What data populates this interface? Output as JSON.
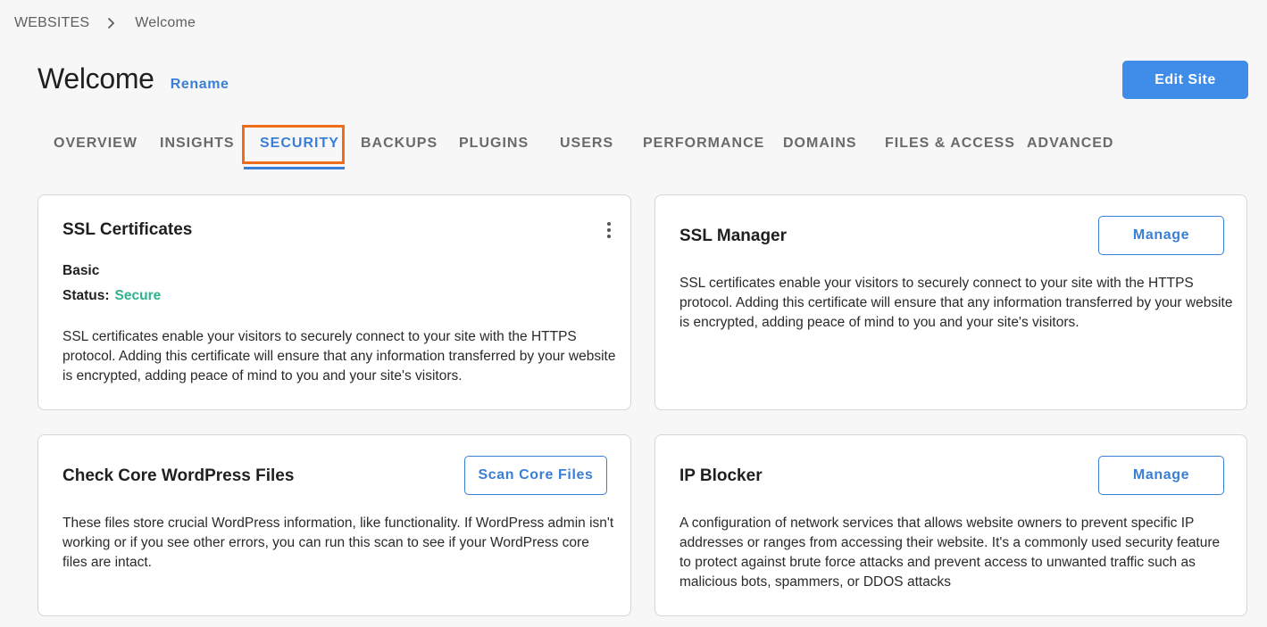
{
  "breadcrumb": {
    "root": "WEBSITES",
    "current": "Welcome"
  },
  "page": {
    "title": "Welcome",
    "rename_label": "Rename",
    "edit_button": "Edit Site"
  },
  "tabs": [
    {
      "label": "OVERVIEW"
    },
    {
      "label": "INSIGHTS"
    },
    {
      "label": "SECURITY",
      "active": true
    },
    {
      "label": "BACKUPS"
    },
    {
      "label": "PLUGINS"
    },
    {
      "label": "USERS"
    },
    {
      "label": "PERFORMANCE"
    },
    {
      "label": "DOMAINS"
    },
    {
      "label": "FILES & ACCESS"
    },
    {
      "label": "ADVANCED"
    }
  ],
  "cards": {
    "ssl_certificates": {
      "title": "SSL Certificates",
      "plan": "Basic",
      "status_label": "Status:",
      "status_value": "Secure",
      "description": "SSL certificates enable your visitors to securely connect to your site with the HTTPS protocol. Adding this certificate will ensure that any information transferred by your website is encrypted, adding peace of mind to you and your site's visitors."
    },
    "ssl_manager": {
      "title": "SSL Manager",
      "button": "Manage",
      "description": "SSL certificates enable your visitors to securely connect to your site with the HTTPS protocol. Adding this certificate will ensure that any information transferred by your website is encrypted, adding peace of mind to you and your site's visitors."
    },
    "core_files": {
      "title": "Check Core WordPress Files",
      "button": "Scan Core Files",
      "description": "These files store crucial WordPress information, like functionality. If WordPress admin isn't working or if you see other errors, you can run this scan to see if your WordPress core files are intact."
    },
    "ip_blocker": {
      "title": "IP Blocker",
      "button": "Manage",
      "description": "A configuration of network services that allows website owners to prevent specific IP addresses or ranges from accessing their website. It's a commonly used security feature to protect against brute force attacks and prevent access to unwanted traffic such as malicious bots, spammers, or DDOS attacks"
    }
  },
  "colors": {
    "accent": "#3a7fd6",
    "primary_button": "#3f8de8",
    "status_secure": "#2fb38a",
    "tab_highlight": "#ef6c1a"
  },
  "icons": {
    "breadcrumb_separator": "chevron-right-icon",
    "card_menu": "more-vertical-icon"
  }
}
